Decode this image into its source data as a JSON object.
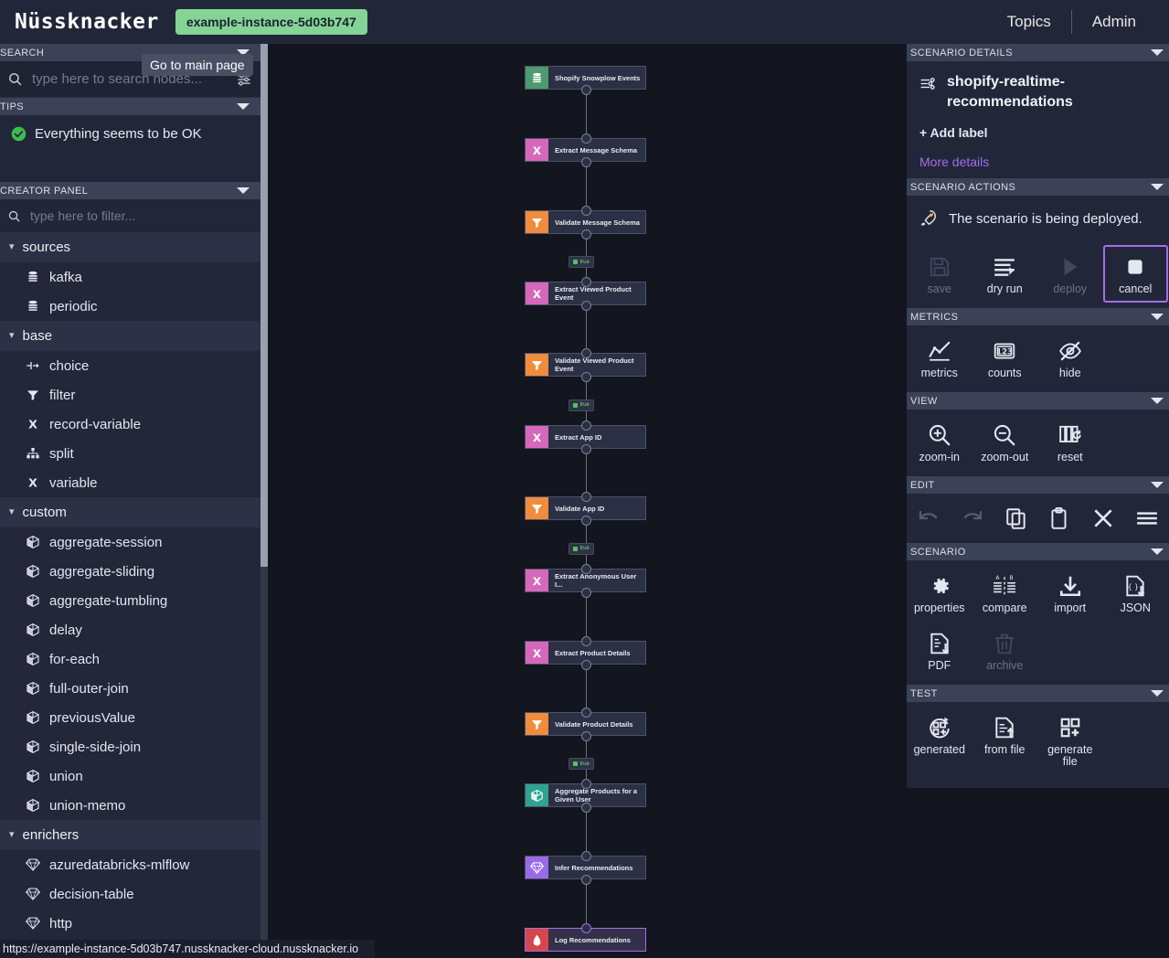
{
  "header": {
    "logo": "Nüssknacker",
    "instance_pill": "example-instance-5d03b747",
    "topics_label": "Topics",
    "admin_label": "Admin"
  },
  "tooltip": {
    "text": "Go to main page"
  },
  "sidebar": {
    "search_panel": {
      "title": "SEARCH",
      "placeholder": "type here to search nodes...",
      "value": ""
    },
    "tips_panel": {
      "title": "TIPS",
      "message": "Everything seems to be OK"
    },
    "creator_panel": {
      "title": "CREATOR PANEL",
      "placeholder": "type here to filter...",
      "value": "",
      "groups": [
        {
          "label": "sources",
          "items": [
            {
              "label": "kafka",
              "icon": "database-icon"
            },
            {
              "label": "periodic",
              "icon": "database-icon"
            }
          ]
        },
        {
          "label": "base",
          "items": [
            {
              "label": "choice",
              "icon": "choice-icon"
            },
            {
              "label": "filter",
              "icon": "filter-icon"
            },
            {
              "label": "record-variable",
              "icon": "variable-x-icon"
            },
            {
              "label": "split",
              "icon": "split-icon"
            },
            {
              "label": "variable",
              "icon": "variable-x-icon"
            }
          ]
        },
        {
          "label": "custom",
          "items": [
            {
              "label": "aggregate-session",
              "icon": "cube-icon"
            },
            {
              "label": "aggregate-sliding",
              "icon": "cube-icon"
            },
            {
              "label": "aggregate-tumbling",
              "icon": "cube-icon"
            },
            {
              "label": "delay",
              "icon": "cube-icon"
            },
            {
              "label": "for-each",
              "icon": "cube-icon"
            },
            {
              "label": "full-outer-join",
              "icon": "cube-icon"
            },
            {
              "label": "previousValue",
              "icon": "cube-icon"
            },
            {
              "label": "single-side-join",
              "icon": "cube-icon"
            },
            {
              "label": "union",
              "icon": "cube-icon"
            },
            {
              "label": "union-memo",
              "icon": "cube-icon"
            }
          ]
        },
        {
          "label": "enrichers",
          "items": [
            {
              "label": "azuredatabricks-mlflow",
              "icon": "diamond-icon"
            },
            {
              "label": "decision-table",
              "icon": "diamond-icon"
            },
            {
              "label": "http",
              "icon": "diamond-icon"
            }
          ]
        }
      ]
    }
  },
  "graph": {
    "nodes": [
      {
        "label": "Shopify Snowplow Events",
        "type": "source",
        "color": "#4c9a6e",
        "icon": "database-icon",
        "selected": false
      },
      {
        "label": "Extract Message Schema",
        "type": "variable",
        "color": "#d668bb",
        "icon": "variable-x-icon",
        "selected": false
      },
      {
        "label": "Validate Message Schema",
        "type": "filter",
        "color": "#f08c3c",
        "icon": "filter-icon",
        "selected": false
      },
      {
        "label": "Extract Viewed Product Event",
        "type": "variable",
        "color": "#d668bb",
        "icon": "variable-x-icon",
        "selected": false
      },
      {
        "label": "Validate Viewed Product Event",
        "type": "filter",
        "color": "#f08c3c",
        "icon": "filter-icon",
        "selected": false
      },
      {
        "label": "Extract App ID",
        "type": "variable",
        "color": "#d668bb",
        "icon": "variable-x-icon",
        "selected": false
      },
      {
        "label": "Validate App ID",
        "type": "filter",
        "color": "#f08c3c",
        "icon": "filter-icon",
        "selected": false
      },
      {
        "label": "Extract Anonymous User I...",
        "type": "variable",
        "color": "#d668bb",
        "icon": "variable-x-icon",
        "selected": false
      },
      {
        "label": "Extract Product Details",
        "type": "variable",
        "color": "#d668bb",
        "icon": "variable-x-icon",
        "selected": false
      },
      {
        "label": "Validate Product Details",
        "type": "filter",
        "color": "#f08c3c",
        "icon": "filter-icon",
        "selected": false
      },
      {
        "label": "Aggregate Products for a Given User",
        "type": "custom",
        "color": "#2fa391",
        "icon": "cube-icon",
        "selected": false
      },
      {
        "label": "Infer Recommendations",
        "type": "enricher",
        "color": "#9a6ae8",
        "icon": "diamond-icon",
        "selected": false
      },
      {
        "label": "Log Recommendations",
        "type": "sink",
        "color": "#d4474a",
        "icon": "sink-icon",
        "selected": true
      }
    ],
    "edge_labels": [
      "true",
      "true",
      "true",
      "true"
    ]
  },
  "rightbar": {
    "scenario_details": {
      "title": "SCENARIO DETAILS",
      "name": "shopify-realtime-recommendations",
      "add_label": "+ Add label",
      "more_details": "More details",
      "accent_color": "#9f6ce8"
    },
    "scenario_actions": {
      "title": "SCENARIO ACTIONS",
      "status_message": "The scenario is being deployed.",
      "buttons": [
        {
          "label": "save",
          "icon": "save-icon",
          "state": "disabled"
        },
        {
          "label": "dry run",
          "icon": "dry-run-icon",
          "state": "enabled"
        },
        {
          "label": "deploy",
          "icon": "deploy-play-icon",
          "state": "disabled"
        },
        {
          "label": "cancel",
          "icon": "cancel-stop-icon",
          "state": "active"
        }
      ]
    },
    "metrics": {
      "title": "METRICS",
      "buttons": [
        {
          "label": "metrics",
          "icon": "chart-line-icon",
          "state": "enabled"
        },
        {
          "label": "counts",
          "icon": "counts-123-icon",
          "state": "enabled"
        },
        {
          "label": "hide",
          "icon": "eye-off-icon",
          "state": "enabled"
        }
      ]
    },
    "view": {
      "title": "VIEW",
      "buttons": [
        {
          "label": "zoom-in",
          "icon": "zoom-in-icon",
          "state": "enabled"
        },
        {
          "label": "zoom-out",
          "icon": "zoom-out-icon",
          "state": "enabled"
        },
        {
          "label": "reset",
          "icon": "reset-layout-icon",
          "state": "enabled"
        }
      ]
    },
    "edit": {
      "title": "EDIT",
      "buttons": [
        {
          "icon": "undo-icon",
          "state": "disabled"
        },
        {
          "icon": "redo-icon",
          "state": "disabled"
        },
        {
          "icon": "copy-icon",
          "state": "enabled"
        },
        {
          "icon": "paste-icon",
          "state": "enabled"
        },
        {
          "icon": "delete-x-icon",
          "state": "enabled"
        },
        {
          "icon": "layout-lines-icon",
          "state": "enabled"
        }
      ]
    },
    "scenario": {
      "title": "SCENARIO",
      "buttons": [
        {
          "label": "properties",
          "icon": "gear-icon",
          "state": "enabled"
        },
        {
          "label": "compare",
          "icon": "compare-ab-icon",
          "state": "enabled"
        },
        {
          "label": "import",
          "icon": "import-download-icon",
          "state": "enabled"
        },
        {
          "label": "JSON",
          "icon": "json-download-icon",
          "state": "enabled"
        },
        {
          "label": "PDF",
          "icon": "pdf-download-icon",
          "state": "enabled"
        },
        {
          "label": "archive",
          "icon": "trash-icon",
          "state": "disabled"
        }
      ]
    },
    "test": {
      "title": "TEST",
      "buttons": [
        {
          "label": "generated",
          "icon": "generated-test-icon",
          "state": "enabled"
        },
        {
          "label": "from file",
          "icon": "file-upload-icon",
          "state": "enabled"
        },
        {
          "label": "generate file",
          "icon": "generate-file-icon",
          "state": "enabled"
        }
      ]
    }
  },
  "statusbar": {
    "url": "https://example-instance-5d03b747.nussknacker-cloud.nussknacker.io"
  }
}
